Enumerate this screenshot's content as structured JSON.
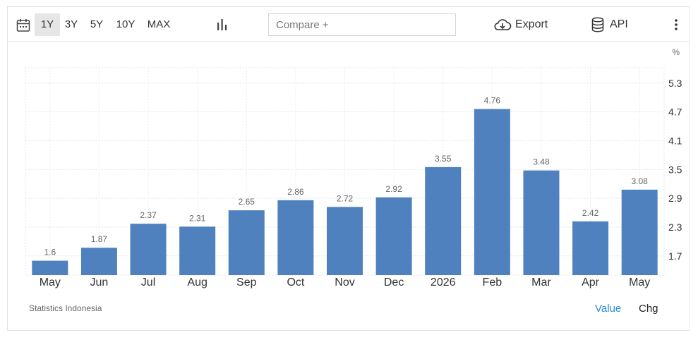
{
  "toolbar": {
    "ranges": [
      "1Y",
      "3Y",
      "5Y",
      "10Y",
      "MAX"
    ],
    "active_range": "1Y",
    "compare_placeholder": "Compare +",
    "export_label": "Export",
    "api_label": "API"
  },
  "chart_data": {
    "type": "bar",
    "categories": [
      "May",
      "Jun",
      "Jul",
      "Aug",
      "Sep",
      "Oct",
      "Nov",
      "Dec",
      "2026",
      "Feb",
      "Mar",
      "Apr",
      "May"
    ],
    "values": [
      1.6,
      1.87,
      2.37,
      2.31,
      2.65,
      2.86,
      2.72,
      2.92,
      3.55,
      4.76,
      3.48,
      2.42,
      3.08
    ],
    "data_labels": [
      "1.6",
      "1.87",
      "2.37",
      "2.31",
      "2.65",
      "2.86",
      "2.72",
      "2.92",
      "3.55",
      "4.76",
      "3.48",
      "2.42",
      "3.08"
    ],
    "y_ticks": [
      "5.3",
      "4.7",
      "4.1",
      "3.5",
      "2.9",
      "2.3",
      "1.7"
    ],
    "ylim": [
      1.3,
      5.62
    ],
    "y_unit": "%",
    "y_axis_side": "right",
    "grid": true,
    "bar_color": "#4e81bd"
  },
  "footer": {
    "source": "Statistics Indonesia",
    "value_label": "Value",
    "chg_label": "Chg",
    "value_color": "#2a8ad6"
  }
}
